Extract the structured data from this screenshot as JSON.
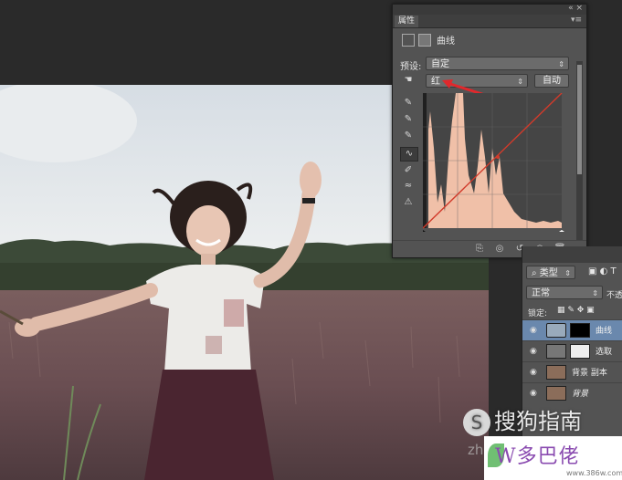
{
  "properties_panel": {
    "tab_label": "属性",
    "title": "曲线",
    "preset_label": "预设:",
    "preset_value": "自定",
    "channel_value": "红",
    "auto_button": "自动"
  },
  "layers_panel": {
    "filter_value": "类型",
    "blend_mode": "正常",
    "opacity_label": "不透",
    "lock_label": "锁定:",
    "layers": [
      {
        "name": "曲线",
        "selected": true
      },
      {
        "name": "选取",
        "selected": false
      },
      {
        "name": "背景 副本",
        "selected": false
      },
      {
        "name": "背景",
        "selected": false
      }
    ]
  },
  "watermarks": {
    "sogou": "搜狗指南",
    "sogou_url": "zhi",
    "site_logo": "W多巴佬",
    "site_url": "www.386w.com"
  },
  "colors": {
    "panel_bg": "#535353",
    "histogram_fill": "#f2c2aa",
    "annotation_arrow": "#e0282c",
    "selected_layer": "#6a88ad"
  }
}
